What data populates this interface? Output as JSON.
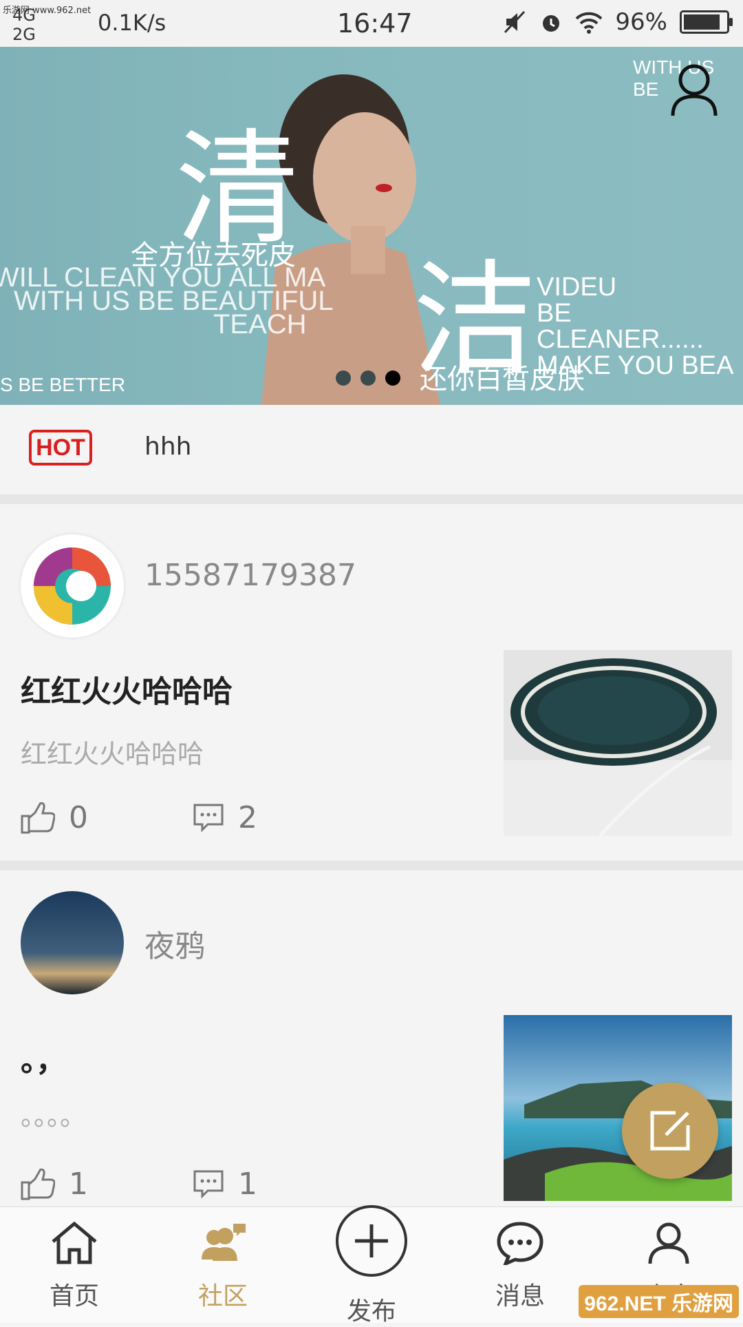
{
  "status_bar": {
    "watermark": "乐游网 www.962.net",
    "network_top": "4G",
    "network_bottom": "2G",
    "speed": "0.1K/s",
    "time": "16:47",
    "battery_percent": "96%",
    "battery_level": 0.96
  },
  "banner": {
    "big_char_1": "清",
    "big_char_2": "洁",
    "cn_line_1": "全方位去死皮",
    "en_line_1": "WILL CLEAN YOU ALL MA",
    "en_line_2": "WITH US BE BEAUTIFUL",
    "en_line_3": "TEACH",
    "en_right_1": "VIDEU",
    "en_right_2": "BE CLEANER......",
    "en_right_3": "MAKE YOU BEA",
    "cn_line_2": "还你白皙皮肤",
    "en_bottom": "S BE BETTER",
    "en_topright": "WITH US BE",
    "carousel_count": 3,
    "carousel_active": 3
  },
  "hot": {
    "badge": "HOT",
    "text": "hhh"
  },
  "posts": [
    {
      "author": "15587179387",
      "title": "红红火火哈哈哈",
      "body": "红红火火哈哈哈",
      "likes": "0",
      "comments": "2"
    },
    {
      "author": "夜鸦",
      "title": "。，",
      "body": "。。。。",
      "likes": "1",
      "comments": "1"
    }
  ],
  "tabs": [
    {
      "label": "首页",
      "icon": "home-icon"
    },
    {
      "label": "社区",
      "icon": "community-icon"
    },
    {
      "label": "发布",
      "icon": "plus-icon"
    },
    {
      "label": "消息",
      "icon": "message-icon"
    },
    {
      "label": "个人",
      "icon": "user-icon"
    }
  ],
  "watermark_br": "962.NET 乐游网",
  "colors": {
    "accent": "#c2a160",
    "hot": "#d92020",
    "banner": "#86b9be"
  }
}
